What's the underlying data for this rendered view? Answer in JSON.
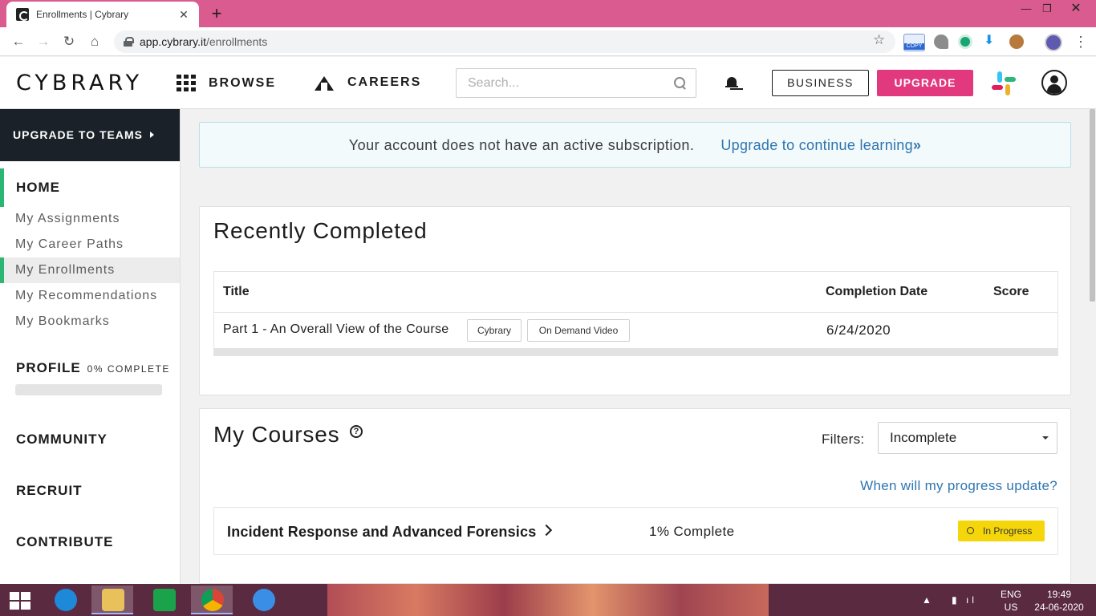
{
  "browser": {
    "tab_title": "Enrollments | Cybrary",
    "url_domain": "app.cybrary.it",
    "url_path": "/enrollments",
    "ext_copy_label": "COPY"
  },
  "header": {
    "logo": "CYBRARY",
    "browse_label": "BROWSE",
    "careers_label": "CAREERS",
    "search_placeholder": "Search...",
    "business_label": "BUSINESS",
    "upgrade_label": "UPGRADE"
  },
  "sidebar": {
    "teams_banner": "UPGRADE TO TEAMS",
    "home": "HOME",
    "links": [
      "My Assignments",
      "My Career Paths",
      "My Enrollments",
      "My Recommendations",
      "My Bookmarks"
    ],
    "profile_label": "PROFILE",
    "profile_complete": "0% COMPLETE",
    "profile_progress": 0,
    "community": "COMMUNITY",
    "recruit": "RECRUIT",
    "contribute": "CONTRIBUTE"
  },
  "alert": {
    "text": "Your account does not have an active subscription.",
    "link": "Upgrade to continue learning"
  },
  "recently_completed": {
    "title": "Recently Completed",
    "columns": [
      "Title",
      "Completion Date",
      "Score"
    ],
    "rows": [
      {
        "title": "Part 1 - An Overall View of the Course",
        "tags": [
          "Cybrary",
          "On Demand Video"
        ],
        "date": "6/24/2020",
        "score": ""
      }
    ]
  },
  "my_courses": {
    "title": "My Courses",
    "help_glyph": "?",
    "filters_label": "Filters:",
    "filter_value": "Incomplete",
    "progress_link": "When will my progress update?",
    "courses": [
      {
        "name": "Incident Response and Advanced Forensics",
        "progress": "1% Complete",
        "status": "In Progress"
      }
    ]
  },
  "taskbar": {
    "lang": "ENG",
    "region": "US",
    "time": "19:49",
    "date": "24-06-2020"
  },
  "colors": {
    "brand_pink": "#e2387d",
    "accent_green": "#2bb673",
    "link_blue": "#2f75b0",
    "status_yellow": "#f5d60a",
    "sidebar_dark": "#1b2128",
    "tab_bar": "#d95b8f"
  }
}
